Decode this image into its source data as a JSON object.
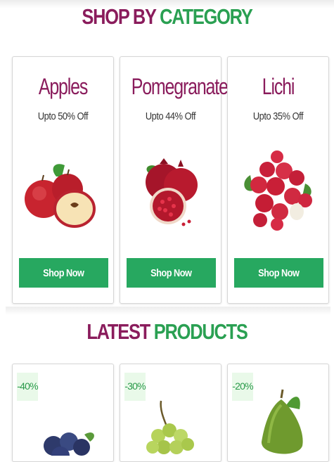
{
  "category_section": {
    "title_part1": "SHOP BY",
    "title_part2": "CATEGORY",
    "cards": [
      {
        "name": "Apples",
        "offer": "Upto 50% Off",
        "button": "Shop Now"
      },
      {
        "name": "Pomegranate",
        "offer": "Upto 44% Off",
        "button": "Shop Now"
      },
      {
        "name": "Lichi",
        "offer": "Upto 35% Off",
        "button": "Shop Now"
      }
    ]
  },
  "latest_section": {
    "title_part1": "LATEST",
    "title_part2": "PRODUCTS",
    "products": [
      {
        "discount": "-40%",
        "image_icon": "blueberries-icon"
      },
      {
        "discount": "-30%",
        "image_icon": "green-grapes-icon"
      },
      {
        "discount": "-20%",
        "image_icon": "avocado-icon"
      }
    ]
  },
  "colors": {
    "title_maroon": "#8a1c5c",
    "title_green": "#2aa052",
    "button_green": "#27a860",
    "badge_bg": "#e9f9e9"
  }
}
